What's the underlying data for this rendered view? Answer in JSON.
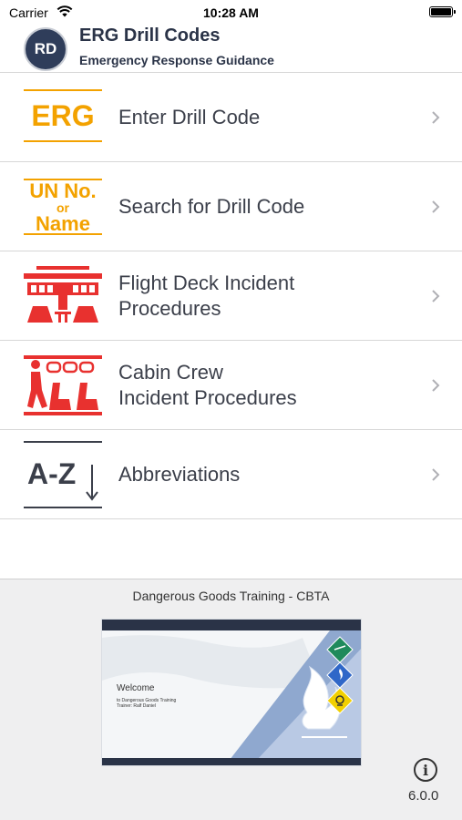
{
  "status_bar": {
    "carrier": "Carrier",
    "time": "10:28 AM"
  },
  "header": {
    "logo": "RD",
    "title": "ERG Drill Codes",
    "subtitle": "Emergency Response Guidance"
  },
  "menu": {
    "items": [
      {
        "label": "Enter Drill Code",
        "icon": "erg-icon",
        "icon_text": "ERG"
      },
      {
        "label": "Search for Drill Code",
        "icon": "un-no-or-name-icon",
        "icon_lines": [
          "UN No.",
          "or",
          "Name"
        ]
      },
      {
        "label": "Flight Deck Incident\nProcedures",
        "icon": "flight-deck-icon"
      },
      {
        "label": "Cabin Crew\nIncident Procedures",
        "icon": "cabin-crew-icon"
      },
      {
        "label": "Abbreviations",
        "icon": "a-z-icon",
        "icon_text": "A-Z"
      }
    ]
  },
  "footer": {
    "title": "Dangerous Goods Training - CBTA",
    "promo": {
      "welcome": "Welcome",
      "sub": "to Dangerous Goods Training\nTrainer: Ralf Daniel"
    },
    "version": "6.0.0"
  },
  "colors": {
    "accent_orange": "#f3a200",
    "accent_red": "#e8312f",
    "navy": "#2f3d5a"
  }
}
